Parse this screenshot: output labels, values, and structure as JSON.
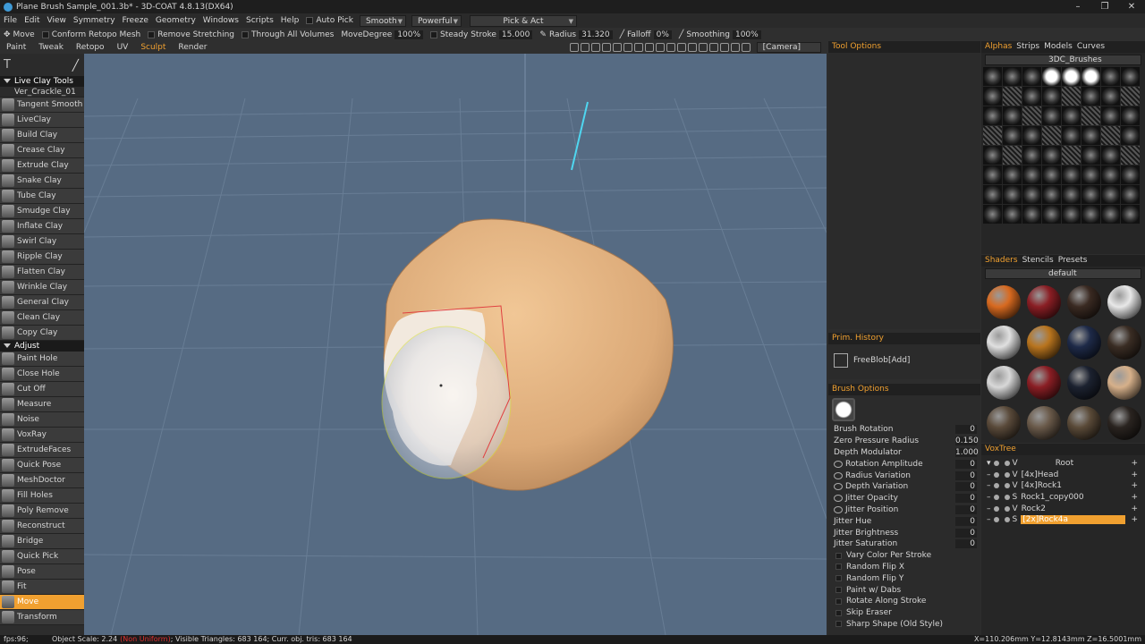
{
  "title": "Plane Brush Sample_001.3b* - 3D-COAT 4.8.13(DX64)",
  "menu": [
    "File",
    "Edit",
    "View",
    "Symmetry",
    "Freeze",
    "Geometry",
    "Windows",
    "Scripts",
    "Help"
  ],
  "auto_pick": "Auto Pick",
  "smooth": "Smooth",
  "powerful": "Powerful",
  "pick_act": "Pick & Act",
  "toolbar2": {
    "move": "Move",
    "conform": "Conform Retopo Mesh",
    "remove_stretching": "Remove Stretching",
    "through_all": "Through All Volumes",
    "move_degree_label": "MoveDegree",
    "move_degree": "100%",
    "steady_label": "Steady Stroke",
    "steady": "15.000",
    "radius_label": "Radius",
    "radius": "31.320",
    "falloff_label": "Falloff",
    "falloff": "0%",
    "smoothing_label": "Smoothing",
    "smoothing": "100%"
  },
  "rooms": [
    "Paint",
    "Tweak",
    "Retopo",
    "UV",
    "Sculpt",
    "Render"
  ],
  "camera": "[Camera]",
  "left": {
    "header1": "Live Clay Tools",
    "sub1": "Ver_Crackle_01",
    "tools1": [
      "Tangent Smooth",
      "LiveClay",
      "Build Clay",
      "Crease Clay",
      "Extrude Clay",
      "Snake Clay",
      "Tube Clay",
      "Smudge Clay",
      "Inflate Clay",
      "Swirl Clay",
      "Ripple Clay",
      "Flatten Clay",
      "Wrinkle Clay",
      "General Clay",
      "Clean Clay",
      "Copy Clay"
    ],
    "header2": "Adjust",
    "tools2": [
      "Paint Hole",
      "Close Hole",
      "Cut Off",
      "Measure",
      "Noise",
      "VoxRay",
      "ExtrudeFaces",
      "Quick Pose",
      "MeshDoctor",
      "Fill Holes",
      "Poly Remove",
      "Reconstruct",
      "Bridge",
      "Quick Pick",
      "Pose",
      "Fit",
      "Move",
      "Transform"
    ]
  },
  "panels": {
    "tool_options": "Tool Options",
    "prim_history": "Prim. History",
    "prim_item": "FreeBlob[Add]",
    "brush_options": "Brush Options"
  },
  "brush_rows": [
    {
      "label": "Brush Rotation",
      "value": "0"
    },
    {
      "label": "Zero Pressure Radius",
      "value": "0.150"
    },
    {
      "label": "Depth Modulator",
      "value": "1.000"
    },
    {
      "label": "Rotation Amplitude",
      "value": "0"
    },
    {
      "label": "Radius Variation",
      "value": "0"
    },
    {
      "label": "Depth Variation",
      "value": "0"
    },
    {
      "label": "Jitter Opacity",
      "value": "0"
    },
    {
      "label": "Jitter Position",
      "value": "0"
    },
    {
      "label": "Jitter Hue",
      "value": "0"
    },
    {
      "label": "Jitter Brightness",
      "value": "0"
    },
    {
      "label": "Jitter Saturation",
      "value": "0"
    }
  ],
  "brush_checks": [
    "Vary Color Per Stroke",
    "Random Flip X",
    "Random Flip Y",
    "Paint w/ Dabs",
    "Rotate Along Stroke",
    "Skip Eraser",
    "Sharp Shape (Old Style)"
  ],
  "alphas": {
    "tabs": [
      "Alphas",
      "Strips",
      "Models",
      "Curves"
    ],
    "preset": "3DC_Brushes"
  },
  "shaders": {
    "tabs": [
      "Shaders",
      "Stencils",
      "Presets"
    ],
    "preset": "default"
  },
  "voxtree": {
    "title": "VoxTree",
    "rows": [
      {
        "type": "V",
        "name": "Root"
      },
      {
        "type": "V",
        "name": "[4x]Head"
      },
      {
        "type": "V",
        "name": "[4x]Rock1"
      },
      {
        "type": "S",
        "name": "Rock1_copy000"
      },
      {
        "type": "V",
        "name": "Rock2"
      },
      {
        "type": "S",
        "name": "[2x]Rock4a"
      }
    ]
  },
  "status": {
    "fps": "fps:96;",
    "scale": "Object Scale: 2.24",
    "non_uniform": "(Non Uniform)",
    "rest": "; Visible Triangles: 683 164; Curr. obj. tris: 683 164",
    "coords": "X=110.206mm  Y=12.8143mm  Z=16.5001mm"
  },
  "colors": {
    "accent": "#f0a030",
    "viewport": "#566b83",
    "clay": "#e4b383"
  }
}
